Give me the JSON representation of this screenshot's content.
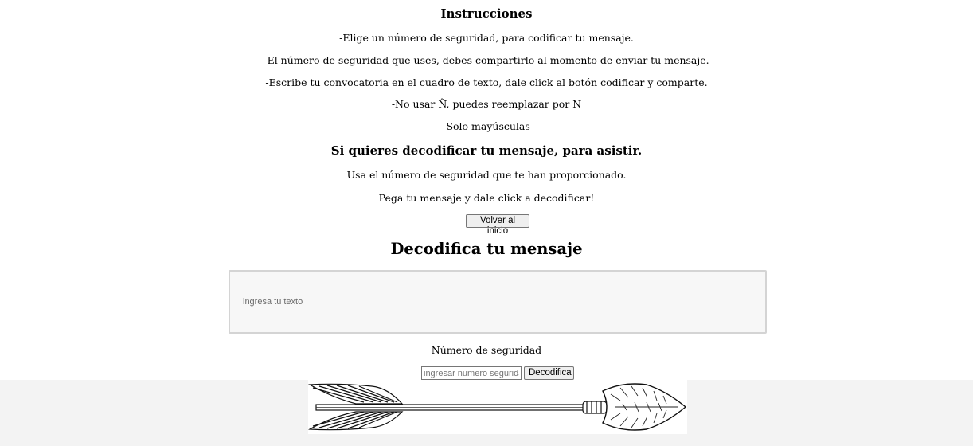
{
  "instructions": {
    "title": "Instrucciones",
    "lines": [
      "-Elige un número de seguridad, para codificar tu mensaje.",
      "-El número de seguridad que uses, debes compartirlo al momento de enviar tu mensaje.",
      "-Escribe tu convocatoria en el cuadro de texto, dale click al botón codificar y comparte.",
      "-No usar Ñ, puedes reemplazar por N",
      "-Solo mayúsculas"
    ]
  },
  "decode_info": {
    "title": "Si quieres decodificar tu mensaje, para asistir.",
    "lines": [
      "Usa el número de seguridad que te han proporcionado.",
      "Pega tu mensaje y dale click a decodificar!"
    ]
  },
  "back_button": {
    "label": "Volver al inicio"
  },
  "decode_section": {
    "title": "Decodifica tu mensaje",
    "message_placeholder": "ingresa tu texto",
    "security_label": "Número de seguridad",
    "security_placeholder": "ingresar numero seguridad",
    "decode_button_label": "Decodifica"
  },
  "decoration": {
    "icon": "arrow-illustration-icon"
  }
}
